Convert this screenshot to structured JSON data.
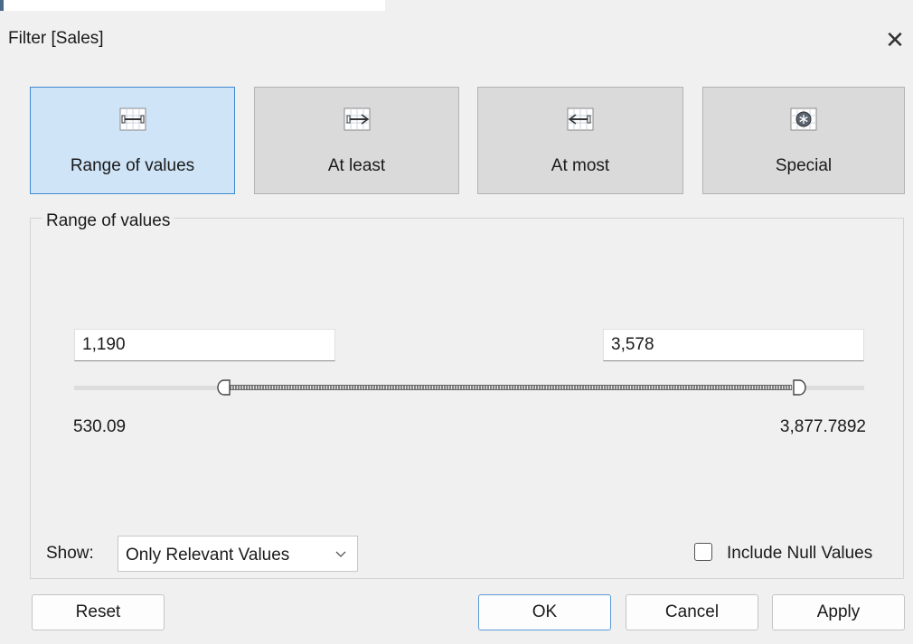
{
  "dialog": {
    "title": "Filter [Sales]"
  },
  "modes": [
    {
      "label": "Range of values",
      "icon": "range-of-values-icon",
      "selected": true
    },
    {
      "label": "At least",
      "icon": "at-least-icon",
      "selected": false
    },
    {
      "label": "At most",
      "icon": "at-most-icon",
      "selected": false
    },
    {
      "label": "Special",
      "icon": "special-icon",
      "selected": false
    }
  ],
  "range": {
    "group_label": "Range of values",
    "min_input": "1,190",
    "max_input": "3,578",
    "domain_min_label": "530.09",
    "domain_max_label": "3,877.7892",
    "domain_min": 530.09,
    "domain_max": 3877.7892,
    "selected_min": 1190,
    "selected_max": 3578
  },
  "options": {
    "show_label": "Show:",
    "show_value": "Only Relevant Values",
    "include_null_label": "Include Null Values",
    "include_null_checked": false
  },
  "buttons": {
    "reset": "Reset",
    "ok": "OK",
    "cancel": "Cancel",
    "apply": "Apply"
  },
  "colors": {
    "active_mode_bg": "#cfe4f7",
    "active_mode_border": "#3f8ad0",
    "mode_bg": "#dadada",
    "primary_border": "#5b9ad6"
  }
}
